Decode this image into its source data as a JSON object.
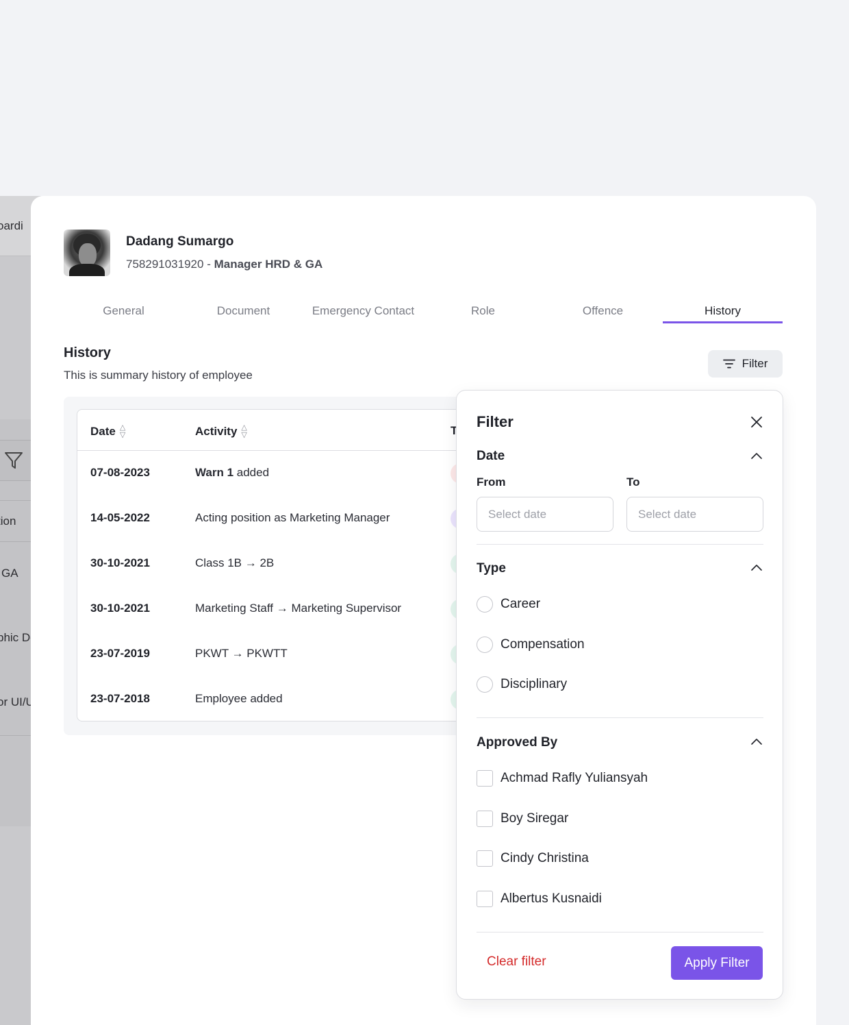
{
  "background": {
    "top_text": "oardi",
    "col_header": "tion",
    "rows": [
      "GA",
      "phic De",
      "or UI/U"
    ]
  },
  "profile": {
    "name": "Dadang Sumargo",
    "employee_id": "758291031920",
    "separator": " - ",
    "position": "Manager HRD & GA"
  },
  "tabs": [
    {
      "label": "General"
    },
    {
      "label": "Document"
    },
    {
      "label": "Emergency Contact"
    },
    {
      "label": "Role"
    },
    {
      "label": "Offence"
    },
    {
      "label": "History",
      "active": true
    }
  ],
  "history": {
    "title": "History",
    "subtitle": "This is summary history of employee",
    "filter_button": "Filter",
    "columns": {
      "date": "Date",
      "activity": "Activity",
      "type_partial": "T"
    },
    "rows": [
      {
        "date": "07-08-2023",
        "activity_bold": "Warn 1",
        "activity": " added",
        "pill_color": "#fde8e8"
      },
      {
        "date": "14-05-2022",
        "activity_bold": "",
        "activity": "Acting position as Marketing Manager",
        "pill_color": "#ebe4fd"
      },
      {
        "date": "30-10-2021",
        "activity_bold": "",
        "activity": "Class 1B → 2B",
        "pill_color": "#e4f6ee"
      },
      {
        "date": "30-10-2021",
        "activity_bold": "",
        "activity": "Marketing Staff → Marketing Supervisor",
        "pill_color": "#e4f6ee"
      },
      {
        "date": "23-07-2019",
        "activity_bold": "",
        "activity": "PKWT → PKWTT",
        "pill_color": "#e4f6ee"
      },
      {
        "date": "23-07-2018",
        "activity_bold": "",
        "activity": "Employee added",
        "pill_color": "#e4f6ee"
      }
    ]
  },
  "filter_panel": {
    "title": "Filter",
    "date": {
      "title": "Date",
      "from_label": "From",
      "to_label": "To",
      "from_placeholder": "Select date",
      "to_placeholder": "Select date"
    },
    "type": {
      "title": "Type",
      "options": [
        "Career",
        "Compensation",
        "Disciplinary"
      ]
    },
    "approved_by": {
      "title": "Approved By",
      "options": [
        "Achmad Rafly Yuliansyah",
        "Boy Siregar",
        "Cindy Christina",
        "Albertus Kusnaidi"
      ]
    },
    "clear_label": "Clear filter",
    "apply_label": "Apply Filter"
  },
  "colors": {
    "accent": "#7a54e8",
    "danger": "#d42b2b"
  }
}
